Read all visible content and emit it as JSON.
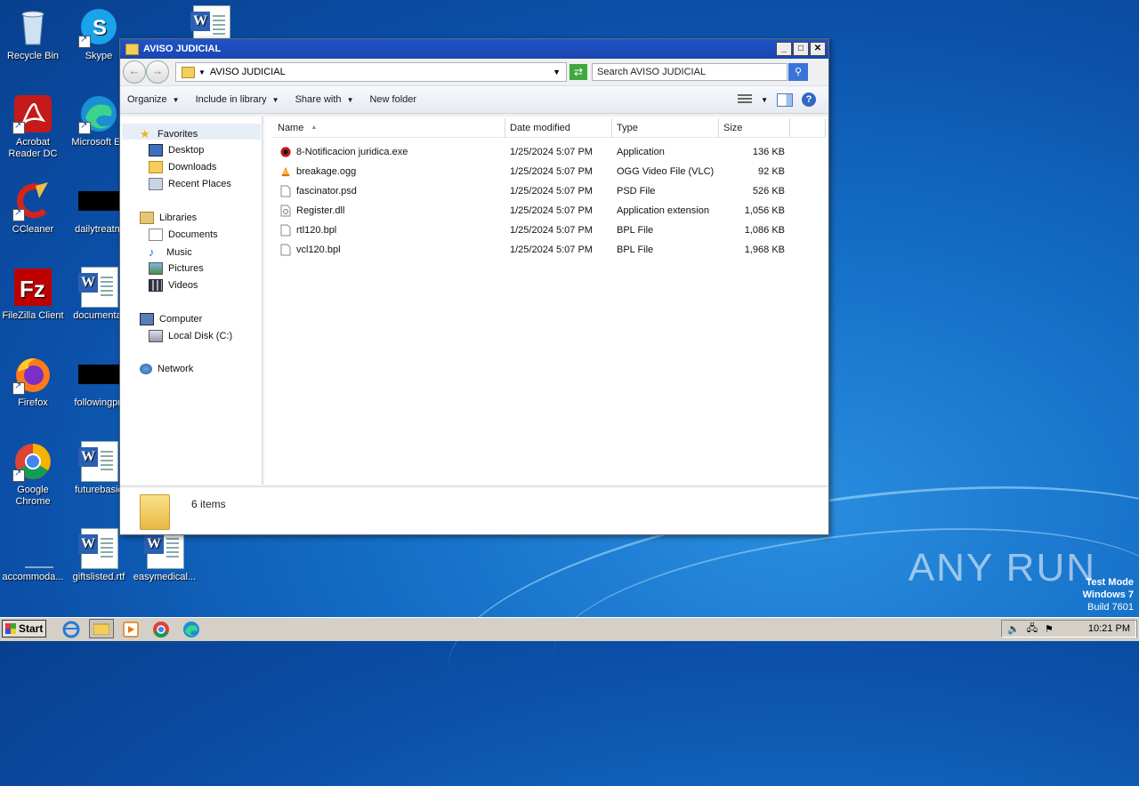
{
  "desktop": {
    "icons": [
      {
        "label": "Recycle Bin"
      },
      {
        "label": "Skype"
      },
      {
        "label": "Acrobat Reader DC"
      },
      {
        "label": "Microsoft Ed"
      },
      {
        "label": "CCleaner"
      },
      {
        "label": "dailytreatm"
      },
      {
        "label": "FileZilla Client"
      },
      {
        "label": "documentat"
      },
      {
        "label": "Firefox"
      },
      {
        "label": "followingpri"
      },
      {
        "label": "Google Chrome"
      },
      {
        "label": "futurebasic"
      },
      {
        "label": "accommoda..."
      },
      {
        "label": "giftslisted.rtf"
      },
      {
        "label": "easymedical..."
      }
    ]
  },
  "window": {
    "title": "AVISO JUDICIAL",
    "address": "AVISO JUDICIAL",
    "search_placeholder": "Search AVISO JUDICIAL",
    "controls": {
      "minimize": "_",
      "maximize": "□",
      "close": "✕"
    }
  },
  "toolbar": {
    "organize": "Organize",
    "include_in_library": "Include in library",
    "share_with": "Share with",
    "new_folder": "New folder"
  },
  "nav": {
    "favorites": "Favorites",
    "desktop": "Desktop",
    "downloads": "Downloads",
    "recent_places": "Recent Places",
    "libraries": "Libraries",
    "documents": "Documents",
    "music": "Music",
    "pictures": "Pictures",
    "videos": "Videos",
    "computer": "Computer",
    "local_disk": "Local Disk (C:)",
    "network": "Network"
  },
  "columns": {
    "name": "Name",
    "date": "Date modified",
    "type": "Type",
    "size": "Size"
  },
  "files": [
    {
      "name": "8-Notificacion juridica.exe",
      "date": "1/25/2024 5:07 PM",
      "type": "Application",
      "size": "136 KB",
      "icon": "exe-icon"
    },
    {
      "name": "breakage.ogg",
      "date": "1/25/2024 5:07 PM",
      "type": "OGG Video File (VLC)",
      "size": "92 KB",
      "icon": "vlc-icon"
    },
    {
      "name": "fascinator.psd",
      "date": "1/25/2024 5:07 PM",
      "type": "PSD File",
      "size": "526 KB",
      "icon": "file-icon"
    },
    {
      "name": "Register.dll",
      "date": "1/25/2024 5:07 PM",
      "type": "Application extension",
      "size": "1,056 KB",
      "icon": "dll-icon"
    },
    {
      "name": "rtl120.bpl",
      "date": "1/25/2024 5:07 PM",
      "type": "BPL File",
      "size": "1,086 KB",
      "icon": "file-icon"
    },
    {
      "name": "vcl120.bpl",
      "date": "1/25/2024 5:07 PM",
      "type": "BPL File",
      "size": "1,968 KB",
      "icon": "file-icon"
    }
  ],
  "details": {
    "count": "6 items"
  },
  "taskbar": {
    "start": "Start",
    "clock": "10:21 PM"
  },
  "watermark": {
    "brand": "ANY RUN",
    "mode": "Test Mode",
    "os": "Windows 7",
    "build": "Build 7601"
  }
}
